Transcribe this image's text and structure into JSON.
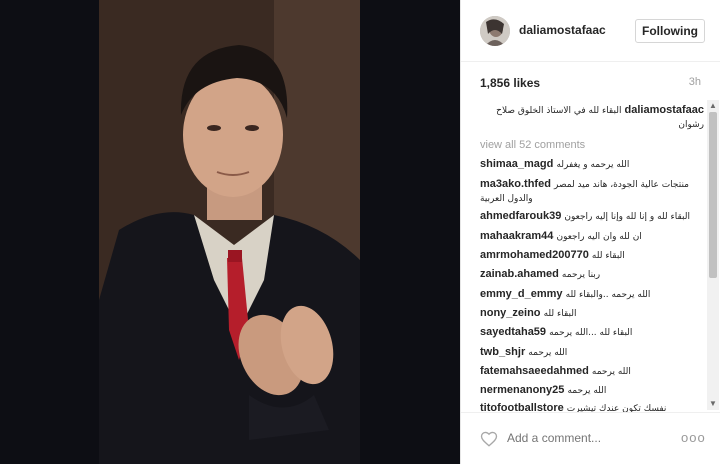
{
  "post": {
    "username": "daliamostafaac",
    "follow_label": "Following",
    "likes": "1,856 likes",
    "time": "3h",
    "caption_user": "daliamostafaac",
    "caption_text": "البقاء لله في الاستاذ الخلوق صلاح رشوان",
    "view_all": "view all 52 comments"
  },
  "comments": [
    {
      "user": "shimaa_magd",
      "text": "الله يرحمه و يغفرله"
    },
    {
      "user": "ma3ako.thfed",
      "text": "منتجات عالية الجودة، هاند ميد لمصر والدول العربية"
    },
    {
      "user": "ahmedfarouk39",
      "text": "البقاء لله و إنا لله وإنا إليه راجعون"
    },
    {
      "user": "mahaakram44",
      "text": "ان لله وان اليه راجعون"
    },
    {
      "user": "amrmohamed200770",
      "text": "البقاء لله"
    },
    {
      "user": "zainab.ahamed",
      "text": "ربنا يرحمه"
    },
    {
      "user": "emmy_d_emmy",
      "text": "الله يرحمه ..والبقاء لله"
    },
    {
      "user": "nony_zeino",
      "text": "البقاء لله"
    },
    {
      "user": "sayedtaha59",
      "text": "البقاء لله ...الله يرحمه"
    },
    {
      "user": "twb_shjr",
      "text": "الله يرحمه"
    },
    {
      "user": "fatemahsaeedahmed",
      "text": "الله يرحمه"
    },
    {
      "user": "nermenanony25",
      "text": "الله يرحمه"
    },
    {
      "user": "titofootballstore",
      "text": "نفسك تكون عندك تيشيرت"
    }
  ],
  "footer": {
    "add_comment_placeholder": "Add a comment...",
    "more_label": "ooo"
  },
  "icons": {
    "heart": "heart-icon",
    "more": "more-options-icon",
    "scroll_up": "scroll-up-icon",
    "scroll_down": "scroll-down-icon"
  }
}
